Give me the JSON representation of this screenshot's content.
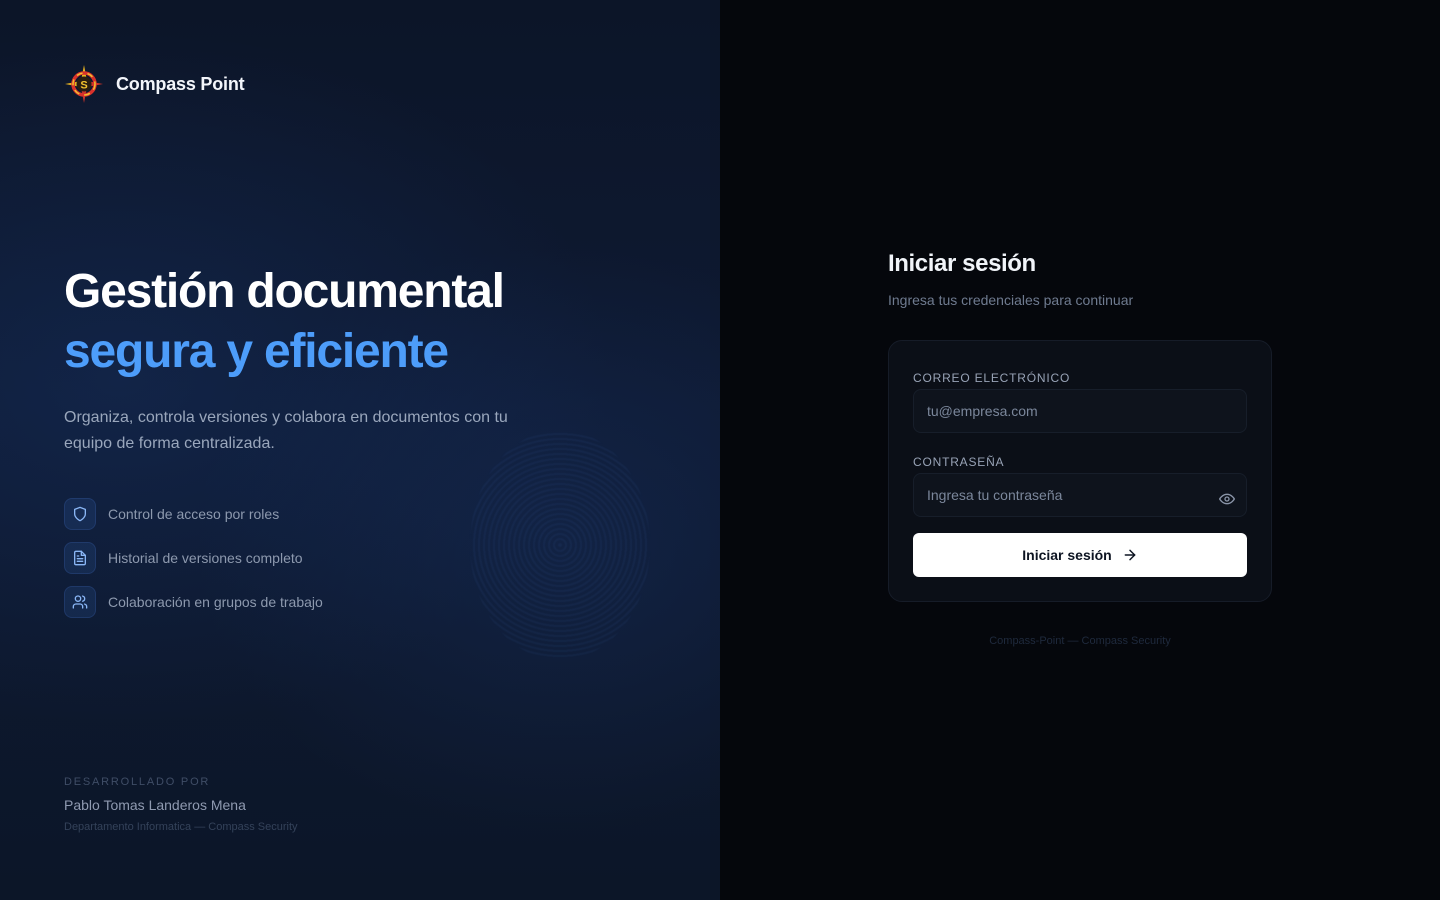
{
  "brand": {
    "name": "Compass Point",
    "logo_icon": "compass-logo-icon"
  },
  "hero": {
    "title_line1": "Gestión documental",
    "title_line2": "segura y eficiente",
    "description": "Organiza, controla versiones y colabora en documentos con tu equipo de forma centralizada."
  },
  "features": [
    {
      "icon": "shield-icon",
      "label": "Control de acceso por roles"
    },
    {
      "icon": "document-icon",
      "label": "Historial de versiones completo"
    },
    {
      "icon": "users-icon",
      "label": "Colaboración en grupos de trabajo"
    }
  ],
  "credits": {
    "kicker": "DESARROLLADO POR",
    "name": "Pablo Tomas Landeros Mena",
    "department": "Departamento Informatica — Compass Security"
  },
  "login": {
    "title": "Iniciar sesión",
    "subtitle": "Ingresa tus credenciales para continuar",
    "email_label": "CORREO ELECTRÓNICO",
    "email_placeholder": "tu@empresa.com",
    "email_value": "",
    "password_label": "CONTRASEÑA",
    "password_placeholder": "Ingresa tu contraseña",
    "password_value": "",
    "submit_label": "Iniciar sesión",
    "footer": "Compass-Point — Compass Security"
  },
  "colors": {
    "accent": "#4d9dfa",
    "left_panel_bg": "#0e1a33",
    "right_panel_bg": "#05070c",
    "button_bg": "#ffffff"
  }
}
